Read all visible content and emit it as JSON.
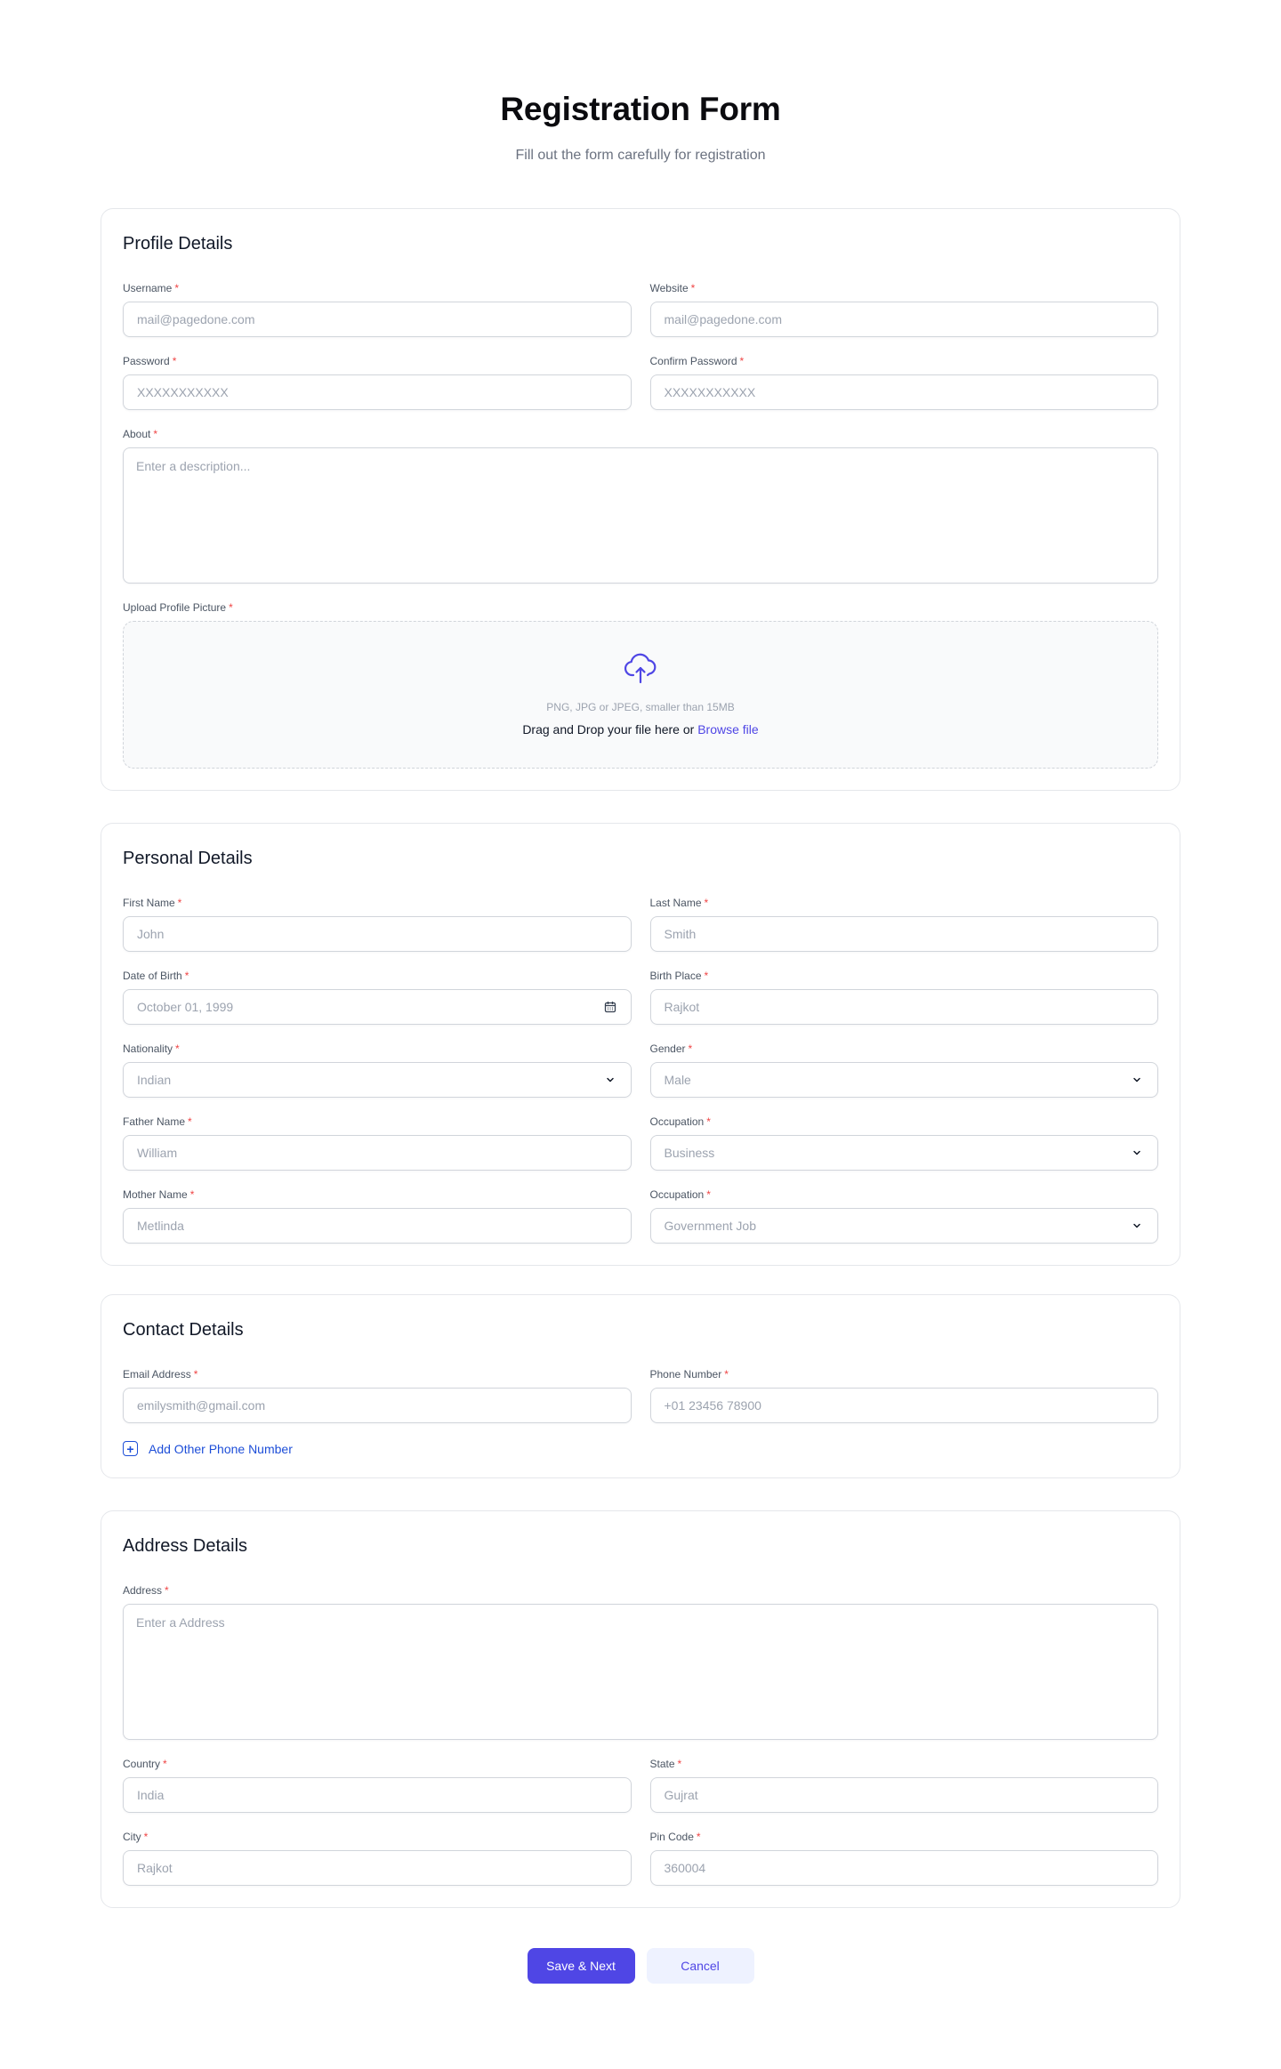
{
  "header": {
    "title": "Registration Form",
    "subtitle": "Fill out the form carefully for registration"
  },
  "required_marker": "*",
  "colors": {
    "primary": "#4f46e5",
    "secondary_bg": "#eef2ff",
    "link": "#1d4ed8",
    "required": "#ef4444",
    "placeholder": "#9ca3af"
  },
  "profile": {
    "title": "Profile Details",
    "username": {
      "label": "Username",
      "placeholder": "mail@pagedone.com"
    },
    "website": {
      "label": "Website",
      "placeholder": "mail@pagedone.com"
    },
    "password": {
      "label": "Password",
      "placeholder": "XXXXXXXXXXX"
    },
    "confirm_password": {
      "label": "Confirm Password",
      "placeholder": "XXXXXXXXXXX"
    },
    "about": {
      "label": "About",
      "placeholder": "Enter a description..."
    },
    "upload": {
      "label": "Upload Profile Picture",
      "icon": "cloud-upload-icon",
      "hint": "PNG, JPG or JPEG, smaller than 15MB",
      "text": "Drag and Drop your file here or",
      "browse_label": "Browse file"
    }
  },
  "personal": {
    "title": "Personal Details",
    "first_name": {
      "label": "First Name",
      "placeholder": "John"
    },
    "last_name": {
      "label": "Last Name",
      "placeholder": "Smith"
    },
    "dob": {
      "label": "Date of Birth",
      "placeholder": "October 01, 1999",
      "icon": "calendar-icon"
    },
    "birth_place": {
      "label": "Birth Place",
      "placeholder": "Rajkot"
    },
    "nationality": {
      "label": "Nationality",
      "value": "Indian",
      "icon": "chevron-down-icon"
    },
    "gender": {
      "label": "Gender",
      "value": "Male",
      "icon": "chevron-down-icon"
    },
    "father_name": {
      "label": "Father Name",
      "placeholder": "William"
    },
    "father_occupation": {
      "label": "Occupation",
      "value": "Business",
      "icon": "chevron-down-icon"
    },
    "mother_name": {
      "label": "Mother Name",
      "placeholder": "Metlinda"
    },
    "mother_occupation": {
      "label": "Occupation",
      "value": "Government Job",
      "icon": "chevron-down-icon"
    }
  },
  "contact": {
    "title": "Contact Details",
    "email": {
      "label": "Email Address",
      "placeholder": "emilysmith@gmail.com"
    },
    "phone": {
      "label": "Phone Number",
      "placeholder": "+01 23456 78900"
    },
    "add_phone": {
      "label": "Add Other Phone Number",
      "icon": "plus-square-icon"
    }
  },
  "address": {
    "title": "Address Details",
    "address": {
      "label": "Address",
      "placeholder": "Enter a Address"
    },
    "country": {
      "label": "Country",
      "placeholder": "India"
    },
    "state": {
      "label": "State",
      "placeholder": "Gujrat"
    },
    "city": {
      "label": "City",
      "placeholder": "Rajkot"
    },
    "pin_code": {
      "label": "Pin Code",
      "placeholder": "360004"
    }
  },
  "actions": {
    "save_label": "Save & Next",
    "cancel_label": "Cancel"
  }
}
